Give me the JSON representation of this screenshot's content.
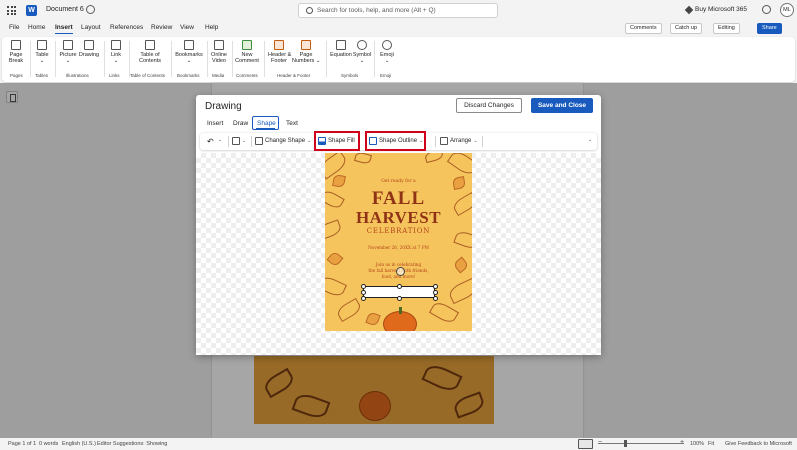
{
  "app": {
    "doc_title": "Document 6",
    "word_logo": "W",
    "search_placeholder": "Search for tools, help, and more (Alt + Q)",
    "buy_label": "Buy Microsoft 365",
    "avatar_initials": "ML"
  },
  "menu": {
    "tabs": [
      "File",
      "Home",
      "Insert",
      "Layout",
      "References",
      "Review",
      "View",
      "Help"
    ],
    "active": "Insert",
    "comments_label": "Comments",
    "catchup_label": "Catch up",
    "editing_label": "Editing",
    "share_label": "Share"
  },
  "ribbon": {
    "buttons": [
      {
        "label": "Page\nBreak"
      },
      {
        "label": "Table\n⌄"
      },
      {
        "label": "Picture\n⌄"
      },
      {
        "label": "Drawing"
      },
      {
        "label": "Link\n⌄"
      },
      {
        "label": "Table of\nContents"
      },
      {
        "label": "Bookmarks\n⌄"
      },
      {
        "label": "Online\nVideo"
      },
      {
        "label": "New\nComment"
      },
      {
        "label": "Header &\nFooter"
      },
      {
        "label": "Page\nNumbers ⌄"
      },
      {
        "label": "Equation"
      },
      {
        "label": "Symbol\n⌄"
      },
      {
        "label": "Emoji\n⌄"
      }
    ],
    "groups": [
      "Pages",
      "Tables",
      "Illustrations",
      "Links",
      "Table of Contents",
      "Bookmarks",
      "Media",
      "Comments",
      "Header & Footer",
      "Symbols",
      "Emoji"
    ]
  },
  "dialog": {
    "title": "Drawing",
    "discard_label": "Discard Changes",
    "save_label": "Save and Close",
    "tabs": [
      "Insert",
      "Draw",
      "Shape",
      "Text"
    ],
    "active_tab": "Shape",
    "toolbar": {
      "change_shape": "Change Shape",
      "shape_fill": "Shape Fill",
      "shape_outline": "Shape Outline",
      "arrange": "Arrange"
    }
  },
  "poster": {
    "line1": "Get ready for a",
    "line2": "FALL",
    "line3": "HARVEST",
    "line4": "CELEBRATION",
    "date": "November 26, 20XX at 7 PM",
    "body1": "Join us in celebrating",
    "body2": "the fall harvest with friends,",
    "body3": "food, and more!"
  },
  "status": {
    "page": "Page 1 of 1",
    "words": "0 words",
    "language": "English (U.S.)",
    "suggestions": "Editor Suggestions: Showing",
    "zoom": "100%",
    "fit": "Fit",
    "feedback": "Give Feedback to Microsoft"
  },
  "colors": {
    "accent": "#185abd",
    "highlight": "#d0021b",
    "poster_bg": "#f5c45c"
  }
}
